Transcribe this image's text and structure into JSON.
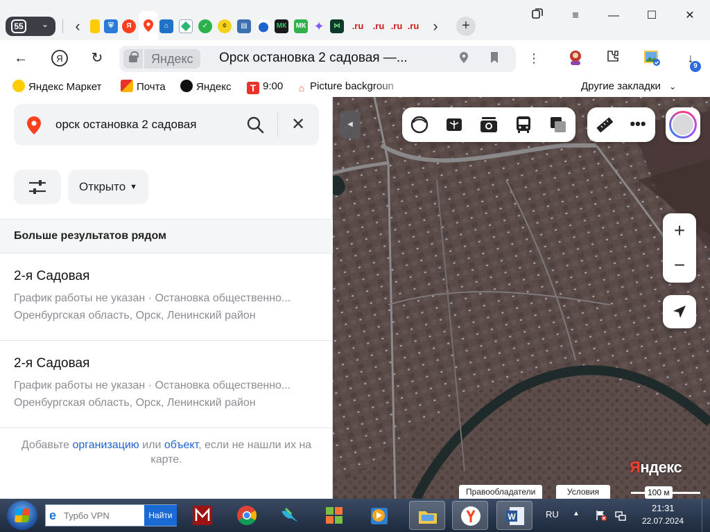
{
  "browser": {
    "tab_count": "55",
    "tabs_favicons": [
      "yandex-market-icon",
      "gosuslugi-icon",
      "yandex-icon",
      "yandex-maps-icon",
      "home-icon",
      "app-icon",
      "check-icon",
      "coin-icon",
      "doc-icon",
      "location-icon",
      "mk-icon",
      "mk-icon",
      "gemini-icon",
      "sprite-icon",
      "ru-site",
      "ru-site",
      "ru-site",
      "ru-site"
    ],
    "mk_label": "МК",
    "ru_label": ".ru",
    "domain": "Яндекс",
    "page_title": "Орск остановка 2 садовая —...",
    "downloads_badge": "9"
  },
  "bookmarks": {
    "items": [
      {
        "label": "Яндекс Маркет",
        "icon": "yandex-market-icon",
        "color": "#ffcc00"
      },
      {
        "label": "Почта",
        "icon": "mail-icon",
        "color": "#e8322a"
      },
      {
        "label": "Яндекс",
        "icon": "yandex-star-icon",
        "color": "#111111"
      },
      {
        "label": "9:00",
        "icon": "t-icon",
        "color": "#e8322a"
      },
      {
        "label": "Picture backgroun",
        "icon": "house-icon",
        "color": "#e4572e"
      }
    ],
    "other": "Другие закладки"
  },
  "panel": {
    "search_query": "орск остановка 2 садовая",
    "filter_open": "Открыто",
    "section_title": "Больше результатов рядом",
    "results": [
      {
        "name": "2-я Садовая",
        "hours": "График работы не указан",
        "type": "Остановка общественно...",
        "address": "Оренбургская область, Орск, Ленинский район"
      },
      {
        "name": "2-я Садовая",
        "hours": "График работы не указан",
        "type": "Остановка общественно...",
        "address": "Оренбургская область, Орск, Ленинский район"
      }
    ],
    "footer": {
      "pre": "Добавьте ",
      "link1": "организацию",
      "mid": " или ",
      "link2": "объект",
      "post": ", если не нашли их на карте."
    }
  },
  "map": {
    "logo_y": "Я",
    "logo_rest": "ндекс",
    "rights": "Правообладатели",
    "terms": "Условия",
    "scale": "100 м",
    "zoom_in": "+",
    "zoom_out": "−"
  },
  "taskbar": {
    "search_placeholder": "Турбо VPN",
    "search_button": "Найти",
    "lang": "RU",
    "time": "21:31",
    "date": "22.07.2024"
  },
  "colors": {
    "yandex_red": "#ff3d2e",
    "link_blue": "#1e63d0",
    "accent_blue": "#2a6ce0"
  }
}
